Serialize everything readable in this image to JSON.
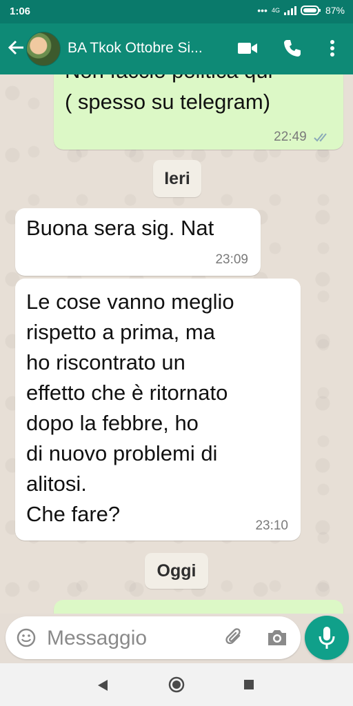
{
  "status_bar": {
    "time": "1:06",
    "dots": "•••",
    "network": "4G",
    "battery": "87%"
  },
  "header": {
    "title": "BA Tkok Ottobre Si..."
  },
  "messages": [
    {
      "direction": "outgoing",
      "text": "Non faccio politica qui\n( spesso su telegram)",
      "time": "22:49",
      "status": "read"
    },
    {
      "type": "day",
      "label": "Ieri"
    },
    {
      "direction": "incoming",
      "text": "Buona sera sig. Nat",
      "time": "23:09"
    },
    {
      "direction": "incoming",
      "text": "Le cose vanno meglio\nrispetto a prima, ma\nho riscontrato un\neffetto che è ritornato\ndopo la febbre, ho\ndi nuovo problemi di\nalitosi.\nChe fare?",
      "time": "23:10"
    },
    {
      "type": "day",
      "label": "Oggi"
    }
  ],
  "composer": {
    "placeholder": "Messaggio"
  },
  "colors": {
    "header": "#0e8a76",
    "outgoing_bubble": "#dcf8c6",
    "incoming_bubble": "#ffffff",
    "mic_button": "#10a08a"
  }
}
